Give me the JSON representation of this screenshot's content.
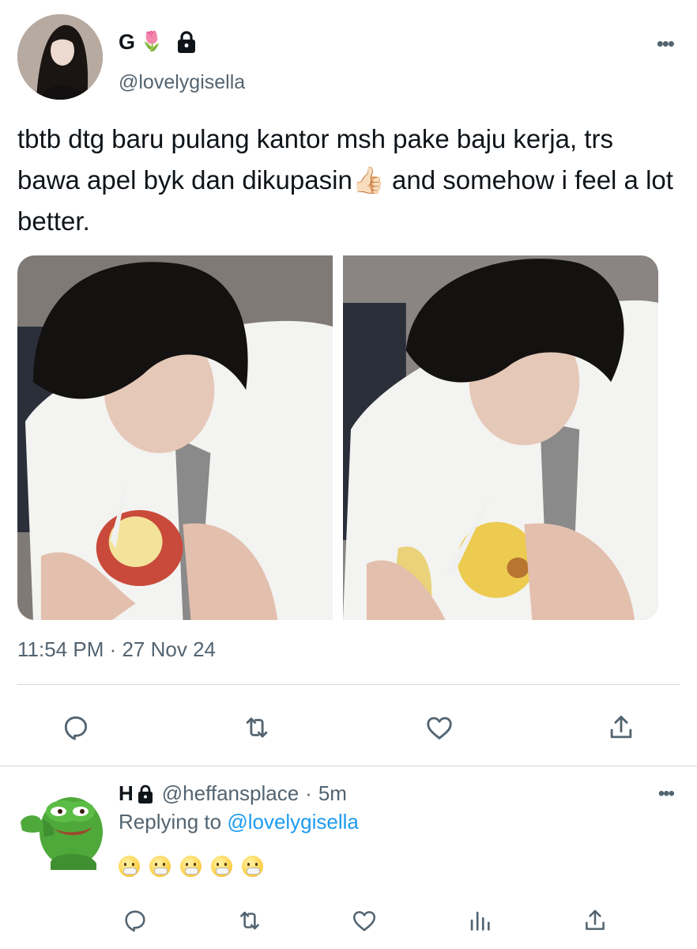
{
  "tweet": {
    "display_name": "G",
    "name_emoji": "🌷",
    "handle": "@lovelygisella",
    "text": "tbtb dtg baru pulang kantor msh pake baju kerja, trs bawa apel byk dan dikupasin👍🏻 and somehow i feel a lot better.",
    "timestamp": "11:54 PM · 27 Nov 24",
    "more": "•••",
    "media_count": 2
  },
  "actions": {
    "icons": [
      "reply-icon",
      "retweet-icon",
      "like-icon",
      "share-icon"
    ]
  },
  "reply": {
    "display_name": "H",
    "handle": "@heffansplace",
    "separator": "·",
    "time": "5m",
    "replying_label": "Replying to",
    "replying_to": "@lovelygisella",
    "emoji_count": 5,
    "more": "•••",
    "icons": [
      "reply-icon",
      "retweet-icon",
      "like-icon",
      "analytics-icon",
      "share-icon"
    ]
  },
  "colors": {
    "text": "#0f1419",
    "secondary": "#536471",
    "link": "#1d9bf0",
    "divider": "#cfd9de"
  }
}
